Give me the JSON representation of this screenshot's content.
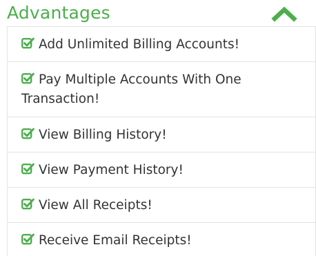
{
  "panel": {
    "title": "Advantages",
    "accent_color": "#4cae4c",
    "toggle_icon": "chevron-up-icon",
    "item_icon": "check-square-icon",
    "items": [
      {
        "label": "Add Unlimited Billing Accounts!"
      },
      {
        "label": "Pay Multiple Accounts With One Transaction!"
      },
      {
        "label": "View Billing History!"
      },
      {
        "label": "View Payment History!"
      },
      {
        "label": "View All Receipts!"
      },
      {
        "label": "Receive Email Receipts!"
      }
    ]
  }
}
